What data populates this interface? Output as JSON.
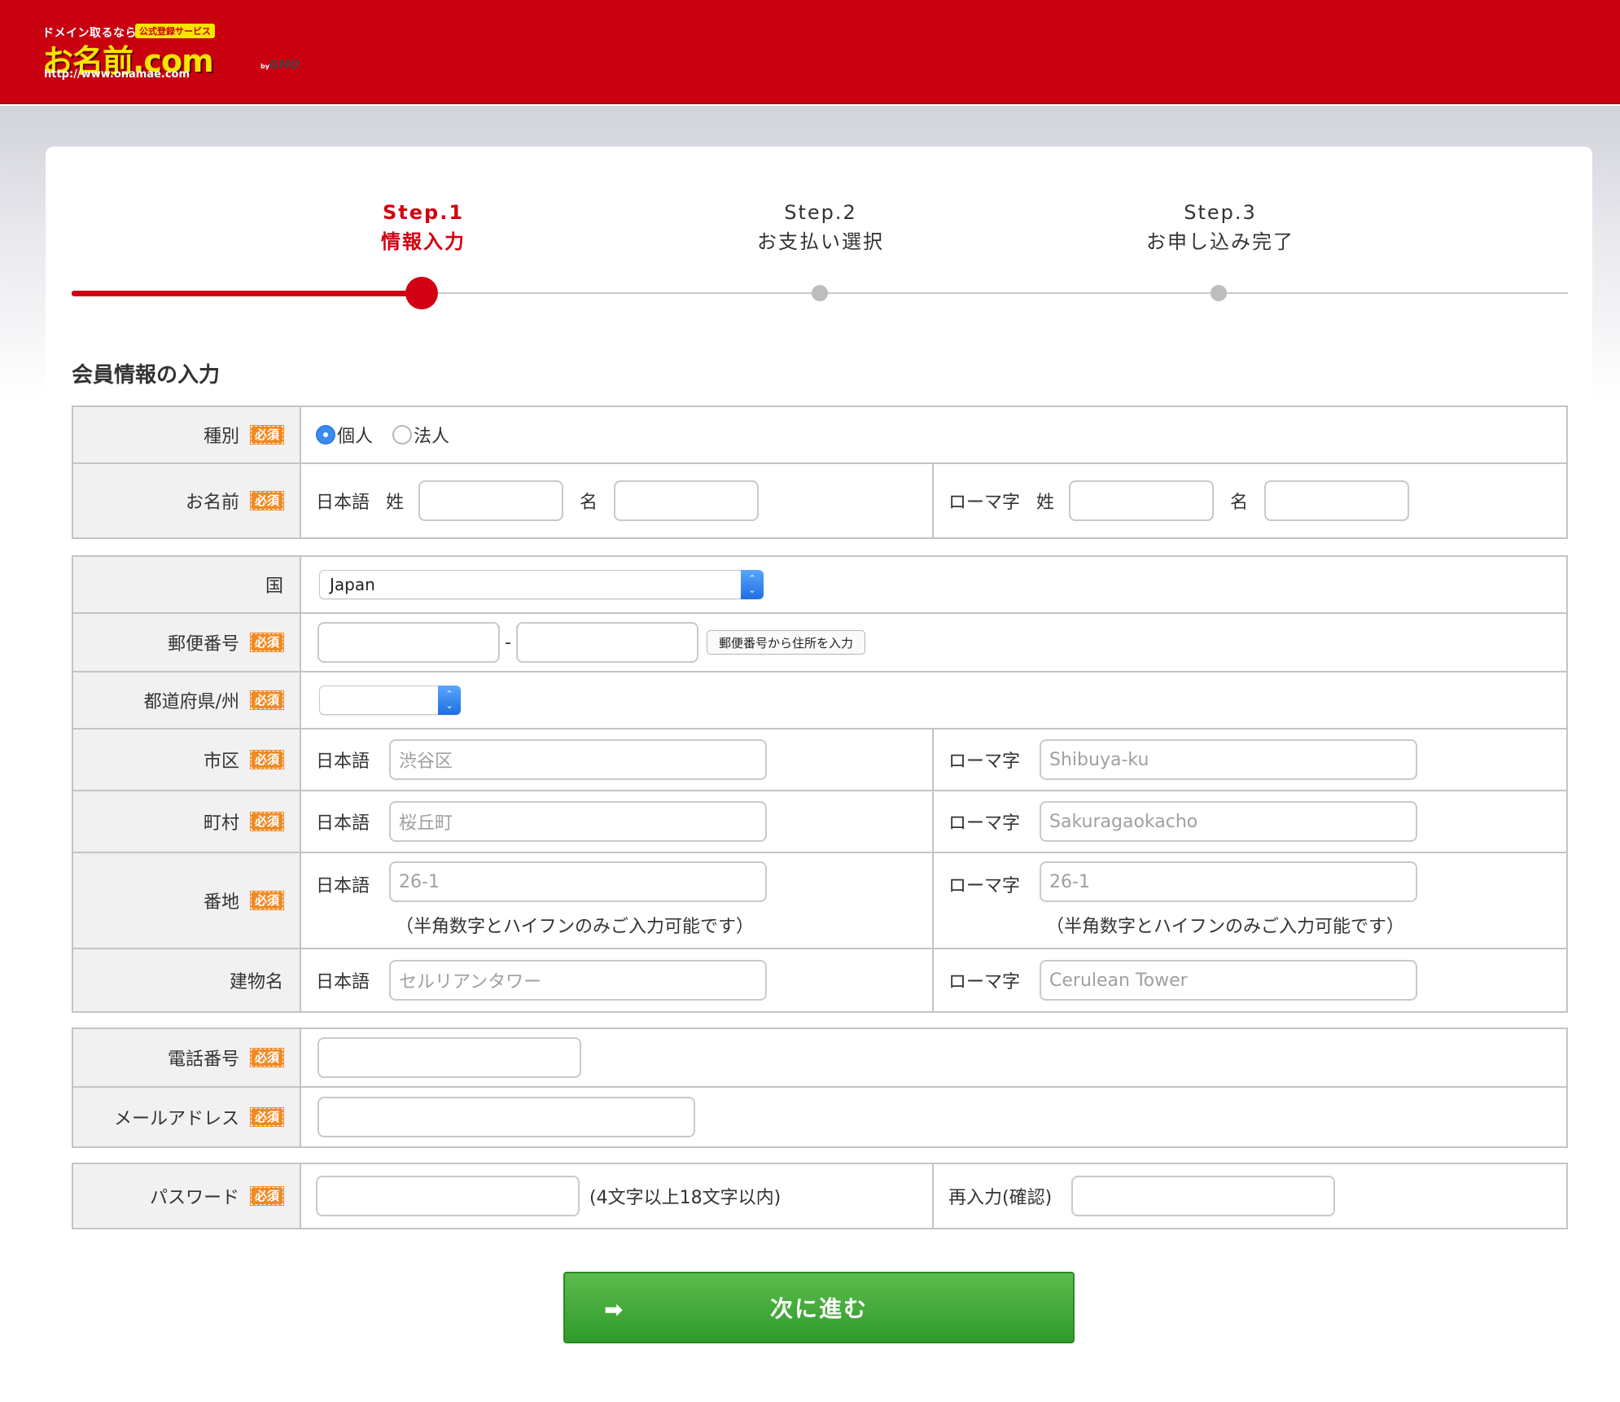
{
  "header": {
    "logo_tag": "ドメイン取るなら",
    "logo_badge": "公式登録サービス",
    "logo_main": "お名前.com",
    "logo_url": "http://www.onamae.com",
    "logo_by": "by",
    "logo_gmo": "GMO"
  },
  "steps": [
    {
      "step": "Step.1",
      "label": "情報入力",
      "active": true
    },
    {
      "step": "Step.2",
      "label": "お支払い選択",
      "active": false
    },
    {
      "step": "Step.3",
      "label": "お申し込み完了",
      "active": false
    }
  ],
  "section_title": "会員情報の入力",
  "required_badge": "必須",
  "form": {
    "type": {
      "label": "種別",
      "options": [
        "個人",
        "法人"
      ],
      "selected": "個人"
    },
    "name": {
      "label": "お名前",
      "jp_label": "日本語",
      "romaji_label": "ローマ字",
      "last_label": "姓",
      "first_label": "名"
    },
    "country": {
      "label": "国",
      "value": "Japan"
    },
    "postal": {
      "label": "郵便番号",
      "separator": "-",
      "lookup_button": "郵便番号から住所を入力"
    },
    "prefecture": {
      "label": "都道府県/州",
      "value": ""
    },
    "city": {
      "label": "市区",
      "jp_label": "日本語",
      "jp_placeholder": "渋谷区",
      "romaji_label": "ローマ字",
      "romaji_placeholder": "Shibuya-ku"
    },
    "town": {
      "label": "町村",
      "jp_label": "日本語",
      "jp_placeholder": "桜丘町",
      "romaji_label": "ローマ字",
      "romaji_placeholder": "Sakuragaokacho"
    },
    "address": {
      "label": "番地",
      "jp_label": "日本語",
      "jp_placeholder": "26-1",
      "romaji_label": "ローマ字",
      "romaji_placeholder": "26-1",
      "note": "（半角数字とハイフンのみご入力可能です）"
    },
    "building": {
      "label": "建物名",
      "jp_label": "日本語",
      "jp_placeholder": "セルリアンタワー",
      "romaji_label": "ローマ字",
      "romaji_placeholder": "Cerulean Tower"
    },
    "phone": {
      "label": "電話番号"
    },
    "email": {
      "label": "メールアドレス"
    },
    "password": {
      "label": "パスワード",
      "note": "(4文字以上18文字以内)",
      "confirm_label": "再入力(確認)"
    }
  },
  "submit_button": "次に進む",
  "colors": {
    "brand_red": "#c9000f",
    "accent_green": "#3fa63a",
    "required_orange": "#f08a24"
  }
}
